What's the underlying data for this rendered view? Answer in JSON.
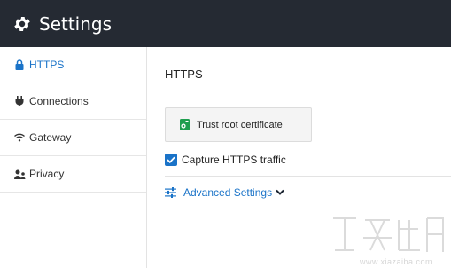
{
  "window": {
    "title": "Settings",
    "icon": "gear-icon"
  },
  "sidebar": {
    "items": [
      {
        "label": "HTTPS",
        "icon": "lock-icon",
        "active": true
      },
      {
        "label": "Connections",
        "icon": "plug-icon",
        "active": false
      },
      {
        "label": "Gateway",
        "icon": "wifi-icon",
        "active": false
      },
      {
        "label": "Privacy",
        "icon": "users-icon",
        "active": false
      }
    ]
  },
  "main": {
    "section_title": "HTTPS",
    "trust_button": {
      "label": "Trust root certificate",
      "icon": "certificate-icon"
    },
    "capture_checkbox": {
      "label": "Capture HTTPS traffic",
      "checked": true
    },
    "advanced": {
      "label": "Advanced Settings",
      "icon": "sliders-icon",
      "chevron": "chevron-down-icon"
    }
  },
  "watermark": {
    "text": "www.xiazaiba.com"
  },
  "colors": {
    "titlebar": "#252a33",
    "accent": "#1a73c8",
    "certificate_green": "#1e9e4e"
  }
}
